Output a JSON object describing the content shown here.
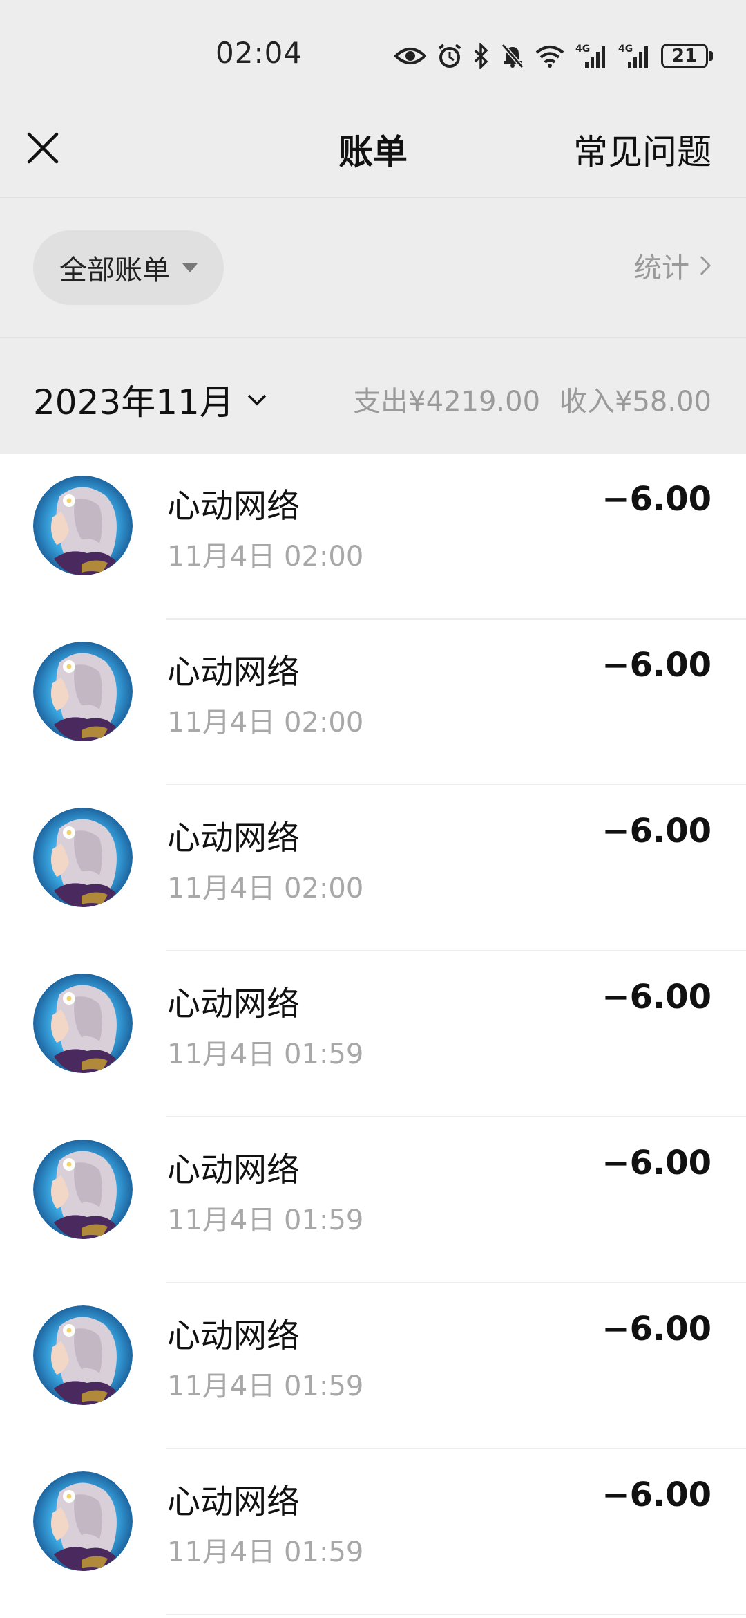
{
  "status_bar": {
    "time": "02:04",
    "icons": [
      "eye-icon",
      "alarm-icon",
      "bluetooth-icon",
      "mute-icon",
      "wifi-icon",
      "signal-4g-icon",
      "signal-4g-icon"
    ],
    "battery": "21"
  },
  "nav": {
    "title": "账单",
    "faq": "常见问题"
  },
  "filter": {
    "chip_label": "全部账单",
    "stats_label": "统计"
  },
  "month": {
    "label": "2023年11月",
    "expense": "支出¥4219.00",
    "income": "收入¥58.00"
  },
  "transactions": [
    {
      "name": "心动网络",
      "time": "11月4日 02:00",
      "amount": "−6.00"
    },
    {
      "name": "心动网络",
      "time": "11月4日 02:00",
      "amount": "−6.00"
    },
    {
      "name": "心动网络",
      "time": "11月4日 02:00",
      "amount": "−6.00"
    },
    {
      "name": "心动网络",
      "time": "11月4日 01:59",
      "amount": "−6.00"
    },
    {
      "name": "心动网络",
      "time": "11月4日 01:59",
      "amount": "−6.00"
    },
    {
      "name": "心动网络",
      "time": "11月4日 01:59",
      "amount": "−6.00"
    },
    {
      "name": "心动网络",
      "time": "11月4日 01:59",
      "amount": "−6.00"
    }
  ],
  "colors": {
    "background": "#ededed",
    "list_background": "#ffffff",
    "secondary_text": "#a8a8a8"
  }
}
